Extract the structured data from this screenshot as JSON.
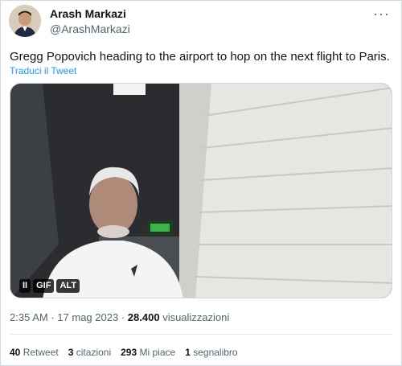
{
  "author": {
    "name": "Arash Markazi",
    "handle": "@ArashMarkazi",
    "avatar_icon": "profile-photo"
  },
  "tweet": {
    "text": "Gregg Popovich heading to the airport to hop on the next flight to Paris.",
    "translate_label": "Traduci il Tweet"
  },
  "media": {
    "pause_label": "II",
    "gif_label": "GIF",
    "alt_label": "ALT"
  },
  "meta": {
    "time": "2:35 AM",
    "separator": "·",
    "date": "17 mag 2023",
    "views_count": "28.400",
    "views_label": "visualizzazioni"
  },
  "stats": {
    "retweets_count": "40",
    "retweets_label": "Retweet",
    "quotes_count": "3",
    "quotes_label": "citazioni",
    "likes_count": "293",
    "likes_label": "Mi piace",
    "bookmarks_count": "1",
    "bookmarks_label": "segnalibro"
  },
  "more_icon": "more-horizontal-icon"
}
